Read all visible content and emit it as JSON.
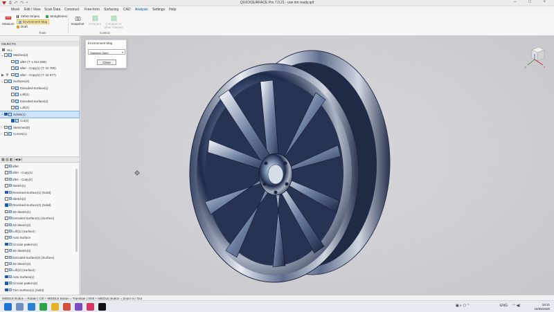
{
  "window": {
    "title": "QUICKSURFACE Pro 7.0.21 - use rim ready.qsf",
    "controls": [
      "–",
      "□",
      "×"
    ]
  },
  "menu": [
    "Mesh",
    "Edit / View",
    "Scan Data",
    "Construct",
    "Free-form",
    "Surfacing",
    "CAD",
    "Analysis",
    "Settings",
    "Help"
  ],
  "ribbon": {
    "measure": "Measure",
    "zebra_stripes": "Zebra Stripes",
    "environment_map": "Environment Map",
    "draft": "Draft",
    "straightness": "Straightness",
    "tools_group": "Tools",
    "snapshot": "Snapshot",
    "compare": "Compare",
    "compare_other": "Compare to other mashes",
    "control_group": "Control"
  },
  "objects": {
    "header": "OBJECTS",
    "all_label": "ALL",
    "items": [
      {
        "label": "Meshes(3)",
        "level": 0,
        "checked": false,
        "expand": "v"
      },
      {
        "label": "after (T: 1 814 556)",
        "level": 1,
        "checked": false
      },
      {
        "label": "after - Copy(1) (T: 22 785)",
        "level": 1,
        "checked": false
      },
      {
        "label": "after - Copy(2) (T: 15 577)",
        "level": 1,
        "checked": false
      },
      {
        "label": "Surfaces(4)",
        "level": 0,
        "checked": false,
        "expand": "v"
      },
      {
        "label": "Extruded-Surface(1)",
        "level": 1,
        "checked": false
      },
      {
        "label": "Loft(1)",
        "level": 1,
        "checked": false
      },
      {
        "label": "Extruded-Surface(2)",
        "level": 1,
        "checked": false
      },
      {
        "label": "Loft(2)",
        "level": 1,
        "checked": false
      },
      {
        "label": "Solids(1)",
        "level": 0,
        "checked": true,
        "expand": "v",
        "selected": true
      },
      {
        "label": "Cut(2)",
        "level": 1,
        "checked": true
      },
      {
        "label": "Sketches(8)",
        "level": 0,
        "checked": false,
        "expand": ">"
      },
      {
        "label": "Curves(1)",
        "level": 0,
        "checked": false,
        "expand": ">"
      }
    ]
  },
  "history": {
    "items": [
      {
        "label": "after",
        "checked": false
      },
      {
        "label": "after - Copy(1)",
        "checked": false
      },
      {
        "label": "after - Copy(2)",
        "checked": false
      },
      {
        "label": "Sketch(1)",
        "checked": false
      },
      {
        "label": "Revolved-Surface(1) (Solid)",
        "checked": true
      },
      {
        "label": "Sketch(2)",
        "checked": false
      },
      {
        "label": "Revolved-Surface(2) (Solid)",
        "checked": true
      },
      {
        "label": "3D Sketch(1)",
        "checked": false
      },
      {
        "label": "Extruded-Surface(1) (Surface)",
        "checked": false
      },
      {
        "label": "2D Sketch(2)",
        "checked": false
      },
      {
        "label": "Loft(1) (Surface)",
        "checked": false
      },
      {
        "label": "Auto Surface",
        "checked": false
      },
      {
        "label": "Circular pattern(1)",
        "checked": true
      },
      {
        "label": "3D Sketch(3)",
        "checked": false
      },
      {
        "label": "Extruded-Surface(2) (Surface)",
        "checked": false
      },
      {
        "label": "3D Sketch(4)",
        "checked": false
      },
      {
        "label": "Loft(2) (Surface)",
        "checked": false
      },
      {
        "label": "Auto Surface(1)",
        "checked": true
      },
      {
        "label": "Circular pattern(2)",
        "checked": true
      },
      {
        "label": "Trim Surface(1) (Solid)",
        "checked": true
      }
    ]
  },
  "env_dialog": {
    "title": "Environment Map",
    "selected": "Stainless Steel",
    "close_label": "Close"
  },
  "status_text": "MIDDLE Button = Rotate | Ctrl + MIDDLE Button = Translate | Shift + MIDDLE Button = Zoom In / Out",
  "taskbar": {
    "lang": "ENG",
    "time": "18:21",
    "date": "16/05/2025"
  },
  "colors": {
    "accent": "#0a4fa8",
    "selection": "#cfe3fa",
    "viewport_bg": "#d2d2d6"
  }
}
